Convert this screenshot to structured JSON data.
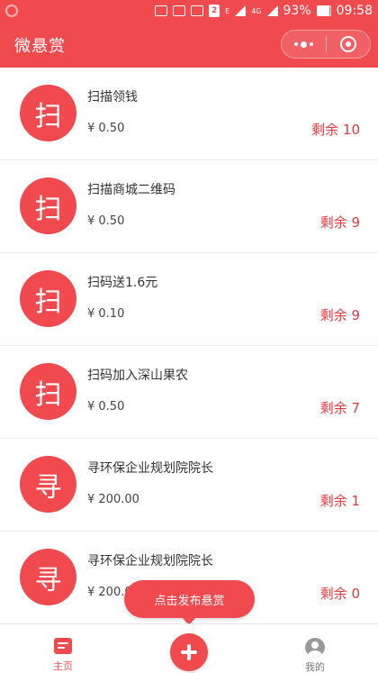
{
  "status_bar": {
    "battery": "93%",
    "time": "09:58",
    "network": "4G",
    "sim_badge": "2",
    "signal_mark": "E"
  },
  "header": {
    "title": "微悬赏"
  },
  "items": [
    {
      "avatar": "扫",
      "title": "扫描领钱",
      "price": "¥ 0.50",
      "remaining": "剩余 10"
    },
    {
      "avatar": "扫",
      "title": "扫描商城二维码",
      "price": "¥ 0.50",
      "remaining": "剩余 9"
    },
    {
      "avatar": "扫",
      "title": "扫码送1.6元",
      "price": "¥ 0.10",
      "remaining": "剩余 9"
    },
    {
      "avatar": "扫",
      "title": "扫码加入深山果农",
      "price": "¥ 0.50",
      "remaining": "剩余 7"
    },
    {
      "avatar": "寻",
      "title": "寻环保企业规划院院长",
      "price": "¥ 200.00",
      "remaining": "剩余 1"
    },
    {
      "avatar": "寻",
      "title": "寻环保企业规划院院长",
      "price": "¥ 200.00",
      "remaining": "剩余 0"
    }
  ],
  "publish_tip": "点击发布悬赏",
  "tabbar": {
    "home_label": "主页",
    "mine_label": "我的"
  },
  "colors": {
    "accent": "#f04a4f",
    "remain_text": "#e8383d"
  }
}
